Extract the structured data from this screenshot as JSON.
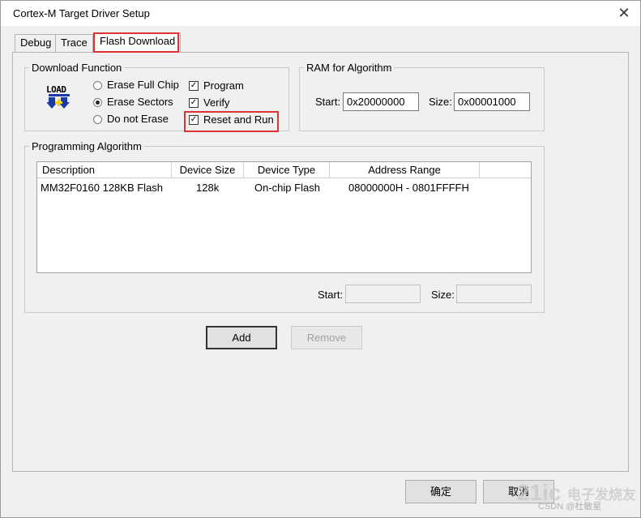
{
  "window": {
    "title": "Cortex-M Target Driver Setup",
    "close_glyph": "✕"
  },
  "tabs": [
    {
      "label": "Debug"
    },
    {
      "label": "Trace"
    },
    {
      "label": "Flash Download"
    }
  ],
  "download_function": {
    "group_label": "Download Function",
    "icon_text": "LOAD",
    "erase_options": [
      {
        "label": "Erase Full Chip",
        "selected": false
      },
      {
        "label": "Erase Sectors",
        "selected": true
      },
      {
        "label": "Do not Erase",
        "selected": false
      }
    ],
    "checks": [
      {
        "label": "Program",
        "checked": true
      },
      {
        "label": "Verify",
        "checked": true
      },
      {
        "label": "Reset and Run",
        "checked": true
      }
    ],
    "check_glyph": "✓"
  },
  "ram": {
    "group_label": "RAM for Algorithm",
    "start_label": "Start:",
    "start_value": "0x20000000",
    "size_label": "Size:",
    "size_value": "0x00001000"
  },
  "programming_algorithm": {
    "group_label": "Programming Algorithm",
    "columns": [
      "Description",
      "Device Size",
      "Device Type",
      "Address Range"
    ],
    "rows": [
      {
        "description": "MM32F0160 128KB Flash",
        "device_size": "128k",
        "device_type": "On-chip Flash",
        "address_range": "08000000H - 0801FFFFH"
      }
    ],
    "start_label": "Start:",
    "start_value": "",
    "size_label": "Size:",
    "size_value": ""
  },
  "buttons": {
    "add": "Add",
    "remove": "Remove",
    "ok": "确定",
    "cancel": "取消"
  },
  "watermark": {
    "site": "电子发烧友",
    "brand": "21ic",
    "author": "CSDN @杜敏星"
  },
  "colors": {
    "highlight": "#e03232",
    "background": "#f0f0f0"
  }
}
